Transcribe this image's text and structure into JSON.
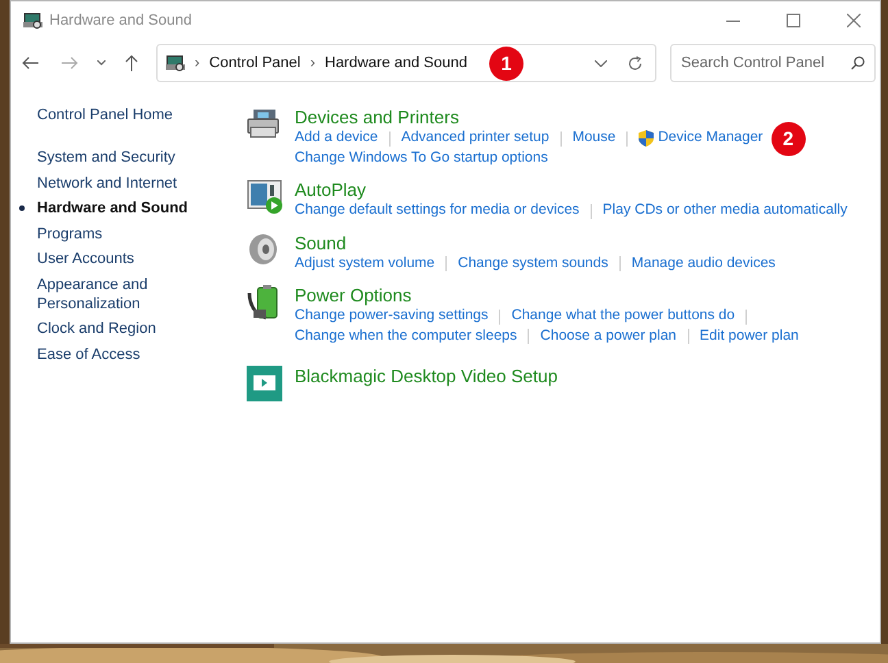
{
  "window": {
    "title": "Hardware and Sound"
  },
  "address_bar": {
    "separator": "›",
    "path": [
      "Control Panel",
      "Hardware and Sound"
    ]
  },
  "search": {
    "placeholder": "Search Control Panel"
  },
  "sidebar": {
    "home": "Control Panel Home",
    "items": [
      {
        "label": "System and Security",
        "selected": false
      },
      {
        "label": "Network and Internet",
        "selected": false
      },
      {
        "label": "Hardware and Sound",
        "selected": true
      },
      {
        "label": "Programs",
        "selected": false
      },
      {
        "label": "User Accounts",
        "selected": false
      },
      {
        "label": "Appearance and Personalization",
        "selected": false
      },
      {
        "label": "Clock and Region",
        "selected": false
      },
      {
        "label": "Ease of Access",
        "selected": false
      }
    ]
  },
  "sections": [
    {
      "kind": "printer",
      "title": "Devices and Printers",
      "rows": [
        {
          "links": [
            {
              "label": "Add a device",
              "admin": false
            },
            {
              "label": "Advanced printer setup",
              "admin": false
            },
            {
              "label": "Mouse",
              "admin": false
            },
            {
              "label": "Device Manager",
              "admin": true,
              "marker": "2"
            }
          ],
          "trailing_separator": false
        },
        {
          "links": [
            {
              "label": "Change Windows To Go startup options"
            }
          ],
          "trailing_separator": false
        }
      ]
    },
    {
      "kind": "autoplay",
      "title": "AutoPlay",
      "rows": [
        {
          "links": [
            {
              "label": "Change default settings for media or devices"
            },
            {
              "label": "Play CDs or other media automatically"
            }
          ],
          "trailing_separator": false
        }
      ]
    },
    {
      "kind": "sound",
      "title": "Sound",
      "rows": [
        {
          "links": [
            {
              "label": "Adjust system volume"
            },
            {
              "label": "Change system sounds"
            },
            {
              "label": "Manage audio devices"
            }
          ],
          "trailing_separator": false
        }
      ]
    },
    {
      "kind": "power",
      "title": "Power Options",
      "rows": [
        {
          "links": [
            {
              "label": "Change power-saving settings"
            },
            {
              "label": "Change what the power buttons do"
            }
          ],
          "trailing_separator": true
        },
        {
          "links": [
            {
              "label": "Change when the computer sleeps"
            },
            {
              "label": "Choose a power plan"
            },
            {
              "label": "Edit power plan"
            }
          ],
          "trailing_separator": false
        }
      ]
    },
    {
      "kind": "video",
      "title": "Blackmagic Desktop Video Setup"
    }
  ],
  "address_marker": "1"
}
